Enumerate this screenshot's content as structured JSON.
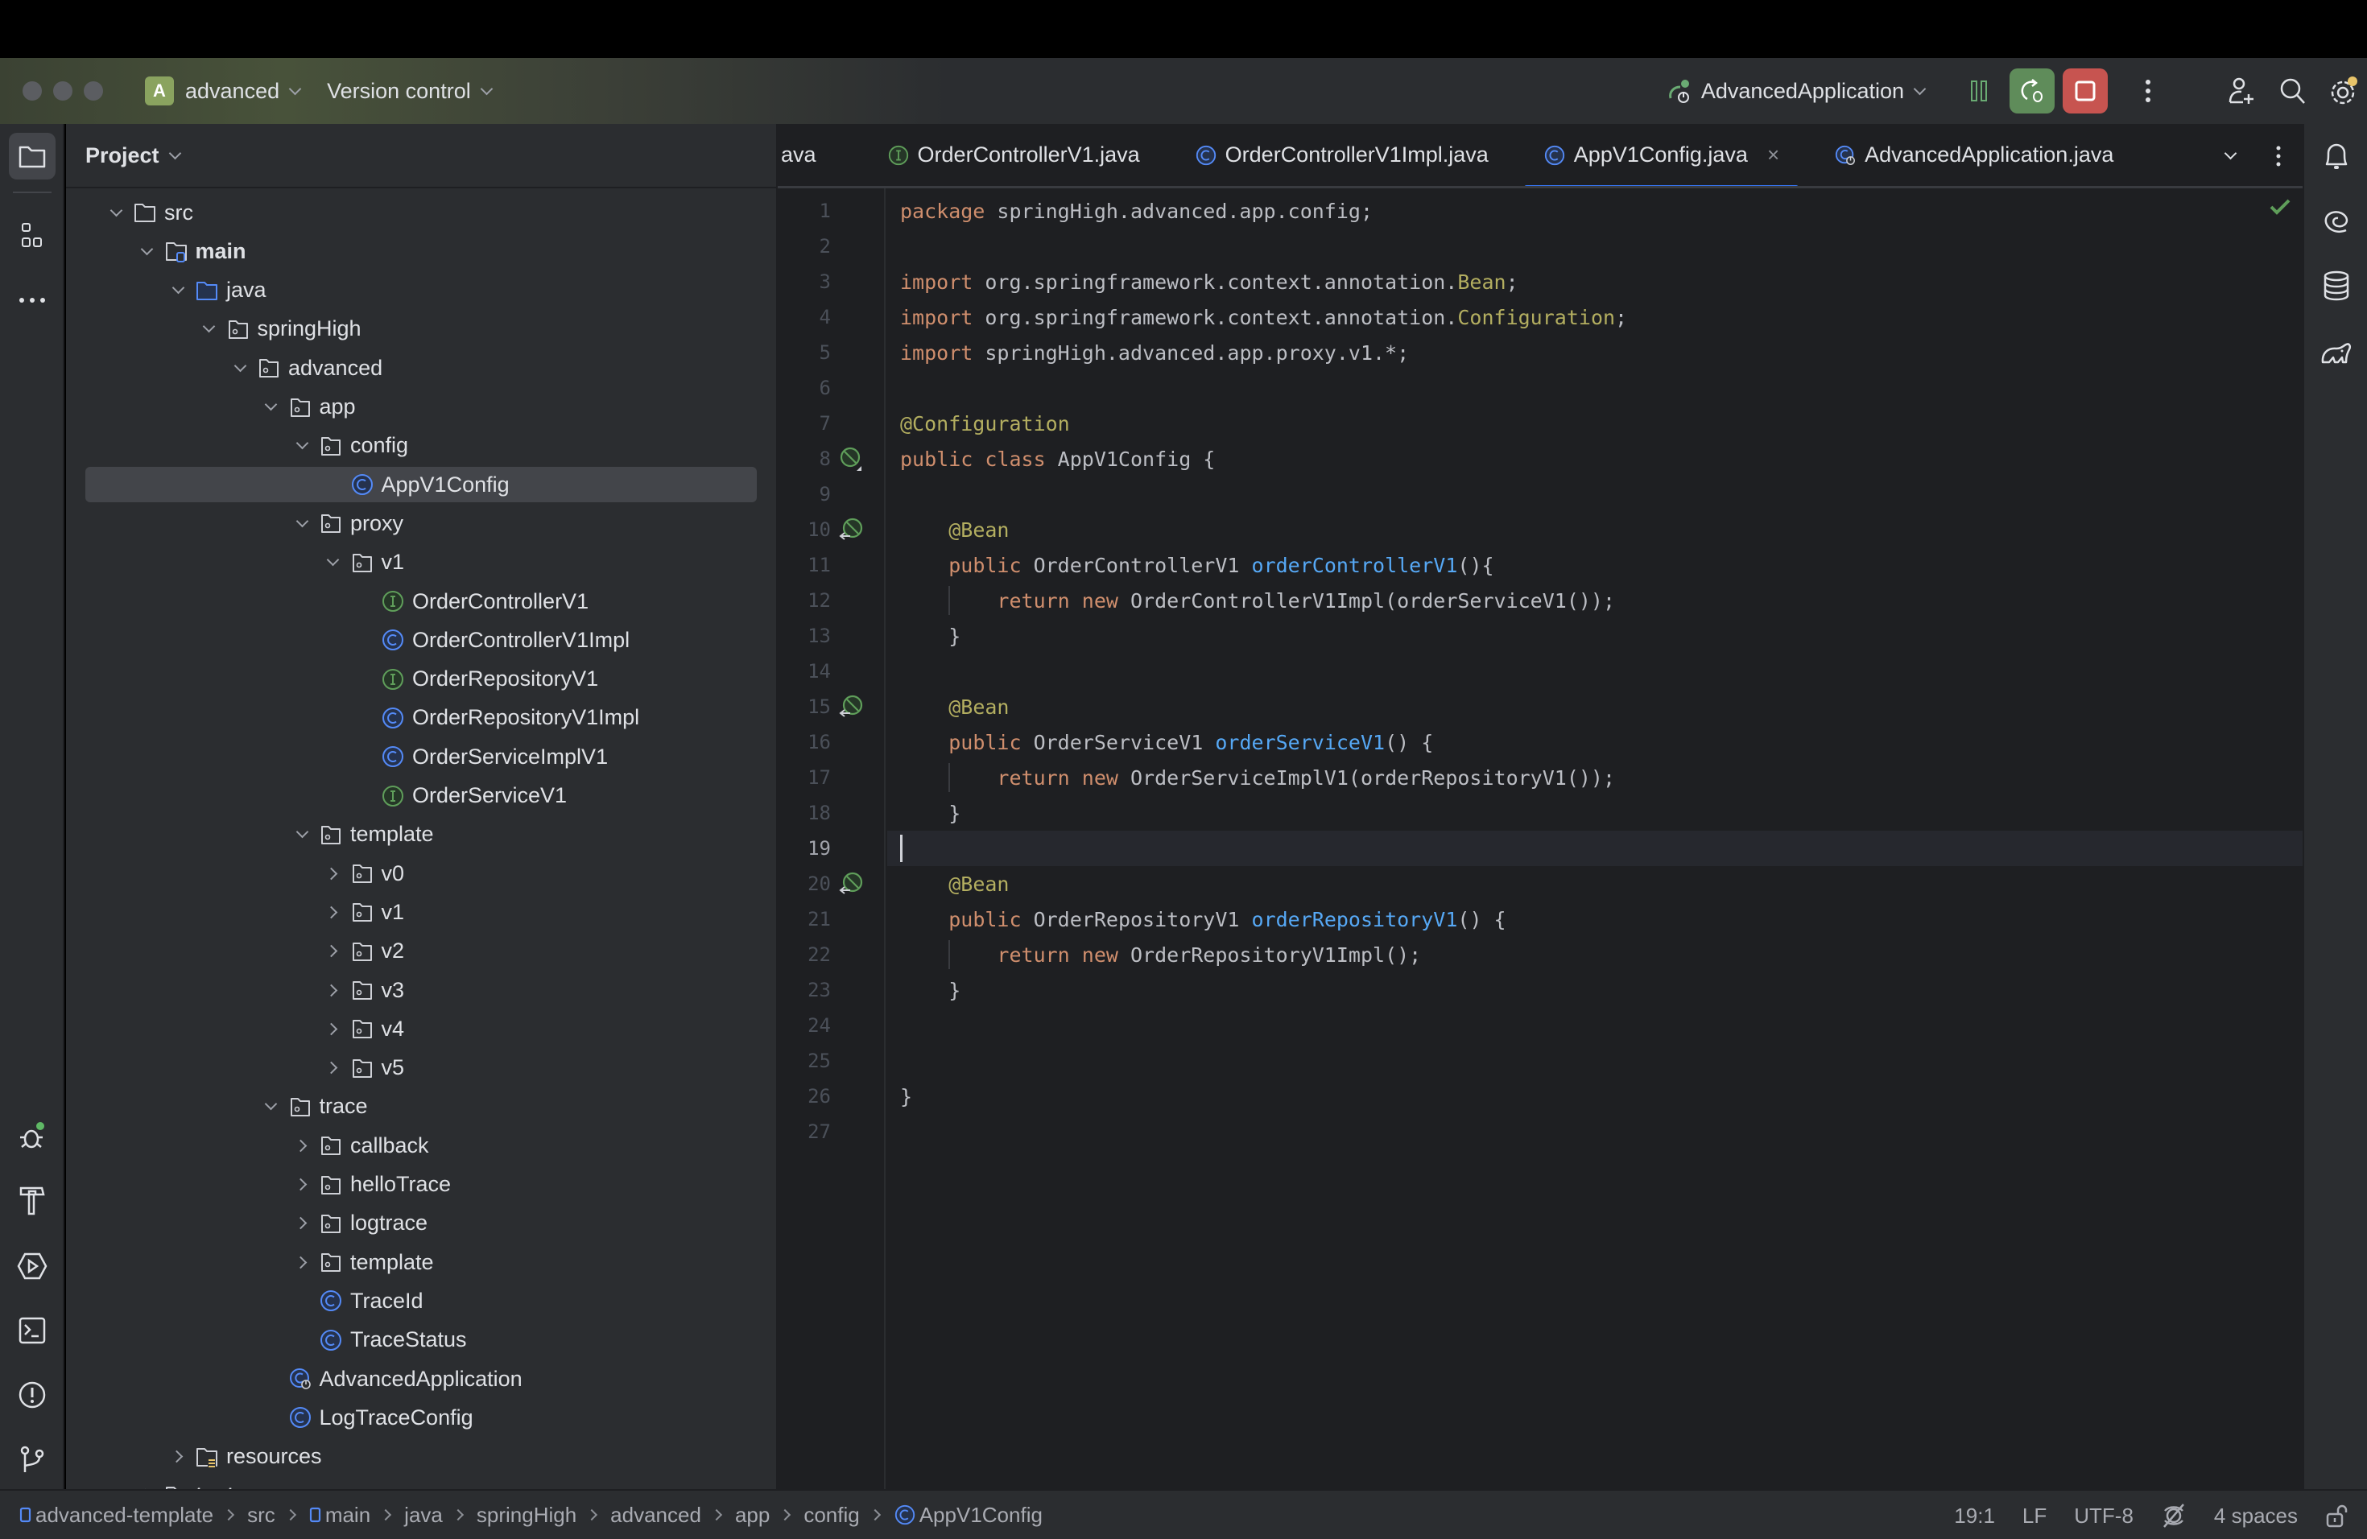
{
  "window": {
    "project_badge": "A",
    "project_name": "advanced",
    "vcs_label": "Version control",
    "run_config": "AdvancedApplication",
    "colors": {
      "accent": "#3574f0",
      "run_green": "#5f8c5a",
      "stop_red": "#c75450",
      "badge": "#8aa35f"
    }
  },
  "project_panel": {
    "title": "Project",
    "tree": [
      {
        "label": "src",
        "depth": 0,
        "arrow": "down",
        "icon": "folder-icon"
      },
      {
        "label": "main",
        "depth": 1,
        "arrow": "down",
        "icon": "source-root-folder-icon",
        "bold": true
      },
      {
        "label": "java",
        "depth": 2,
        "arrow": "down",
        "icon": "java-source-folder-icon"
      },
      {
        "label": "springHigh",
        "depth": 3,
        "arrow": "down",
        "icon": "package-icon"
      },
      {
        "label": "advanced",
        "depth": 4,
        "arrow": "down",
        "icon": "package-icon"
      },
      {
        "label": "app",
        "depth": 5,
        "arrow": "down",
        "icon": "package-icon"
      },
      {
        "label": "config",
        "depth": 6,
        "arrow": "down",
        "icon": "package-icon"
      },
      {
        "label": "AppV1Config",
        "depth": 7,
        "arrow": "none",
        "icon": "class-icon",
        "selected": true
      },
      {
        "label": "proxy",
        "depth": 6,
        "arrow": "down",
        "icon": "package-icon"
      },
      {
        "label": "v1",
        "depth": 7,
        "arrow": "down",
        "icon": "package-icon"
      },
      {
        "label": "OrderControllerV1",
        "depth": 8,
        "arrow": "none",
        "icon": "interface-icon"
      },
      {
        "label": "OrderControllerV1Impl",
        "depth": 8,
        "arrow": "none",
        "icon": "class-icon"
      },
      {
        "label": "OrderRepositoryV1",
        "depth": 8,
        "arrow": "none",
        "icon": "interface-icon"
      },
      {
        "label": "OrderRepositoryV1Impl",
        "depth": 8,
        "arrow": "none",
        "icon": "class-icon"
      },
      {
        "label": "OrderServiceImplV1",
        "depth": 8,
        "arrow": "none",
        "icon": "class-icon"
      },
      {
        "label": "OrderServiceV1",
        "depth": 8,
        "arrow": "none",
        "icon": "interface-icon"
      },
      {
        "label": "template",
        "depth": 6,
        "arrow": "down",
        "icon": "package-icon"
      },
      {
        "label": "v0",
        "depth": 7,
        "arrow": "right",
        "icon": "package-icon"
      },
      {
        "label": "v1",
        "depth": 7,
        "arrow": "right",
        "icon": "package-icon"
      },
      {
        "label": "v2",
        "depth": 7,
        "arrow": "right",
        "icon": "package-icon"
      },
      {
        "label": "v3",
        "depth": 7,
        "arrow": "right",
        "icon": "package-icon"
      },
      {
        "label": "v4",
        "depth": 7,
        "arrow": "right",
        "icon": "package-icon"
      },
      {
        "label": "v5",
        "depth": 7,
        "arrow": "right",
        "icon": "package-icon"
      },
      {
        "label": "trace",
        "depth": 5,
        "arrow": "down",
        "icon": "package-icon"
      },
      {
        "label": "callback",
        "depth": 6,
        "arrow": "right",
        "icon": "package-icon"
      },
      {
        "label": "helloTrace",
        "depth": 6,
        "arrow": "right",
        "icon": "package-icon"
      },
      {
        "label": "logtrace",
        "depth": 6,
        "arrow": "right",
        "icon": "package-icon"
      },
      {
        "label": "template",
        "depth": 6,
        "arrow": "right",
        "icon": "package-icon"
      },
      {
        "label": "TraceId",
        "depth": 6,
        "arrow": "none",
        "icon": "class-icon"
      },
      {
        "label": "TraceStatus",
        "depth": 6,
        "arrow": "none",
        "icon": "class-icon"
      },
      {
        "label": "AdvancedApplication",
        "depth": 5,
        "arrow": "none",
        "icon": "spring-boot-class-icon"
      },
      {
        "label": "LogTraceConfig",
        "depth": 5,
        "arrow": "none",
        "icon": "class-icon"
      },
      {
        "label": "resources",
        "depth": 2,
        "arrow": "right",
        "icon": "resources-folder-icon"
      },
      {
        "label": "test",
        "depth": 1,
        "arrow": "right",
        "icon": "test-folder-icon",
        "bold": true
      }
    ]
  },
  "editor": {
    "tabs": [
      {
        "label": "ava",
        "icon": "none",
        "active": false
      },
      {
        "label": "OrderControllerV1.java",
        "icon": "interface-icon",
        "active": false
      },
      {
        "label": "OrderControllerV1Impl.java",
        "icon": "class-icon",
        "active": false
      },
      {
        "label": "AppV1Config.java",
        "icon": "class-icon",
        "active": true,
        "closable": true
      },
      {
        "label": "AdvancedApplication.java",
        "icon": "spring-boot-class-icon",
        "active": false
      }
    ],
    "current_line": 19,
    "lines": [
      {
        "n": "1",
        "tokens": [
          [
            "kw",
            "package"
          ],
          [
            "t",
            " springHigh.advanced.app.config;"
          ]
        ]
      },
      {
        "n": "2",
        "tokens": []
      },
      {
        "n": "3",
        "tokens": [
          [
            "kw",
            "import"
          ],
          [
            "t",
            " org.springframework.context.annotation."
          ],
          [
            "ann",
            "Bean"
          ],
          [
            "t",
            ";"
          ]
        ]
      },
      {
        "n": "4",
        "tokens": [
          [
            "kw",
            "import"
          ],
          [
            "t",
            " org.springframework.context.annotation."
          ],
          [
            "ann",
            "Configuration"
          ],
          [
            "t",
            ";"
          ]
        ]
      },
      {
        "n": "5",
        "tokens": [
          [
            "kw",
            "import"
          ],
          [
            "t",
            " springHigh.advanced.app.proxy.v1.*;"
          ]
        ]
      },
      {
        "n": "6",
        "tokens": []
      },
      {
        "n": "7",
        "tokens": [
          [
            "ann",
            "@Configuration"
          ]
        ]
      },
      {
        "n": "8",
        "gutter": "spring-bean-config-icon",
        "tokens": [
          [
            "kw",
            "public class"
          ],
          [
            "t",
            " AppV1Config {"
          ]
        ]
      },
      {
        "n": "9",
        "tokens": []
      },
      {
        "n": "10",
        "gutter": "spring-bean-icon",
        "tokens": [
          [
            "t",
            "    "
          ],
          [
            "ann",
            "@Bean"
          ]
        ]
      },
      {
        "n": "11",
        "tokens": [
          [
            "t",
            "    "
          ],
          [
            "kw",
            "public"
          ],
          [
            "t",
            " OrderControllerV1 "
          ],
          [
            "fn",
            "orderControllerV1"
          ],
          [
            "t",
            "(){"
          ]
        ]
      },
      {
        "n": "12",
        "tokens": [
          [
            "t",
            "        "
          ],
          [
            "kw",
            "return new"
          ],
          [
            "t",
            " OrderControllerV1Impl(orderServiceV1());"
          ]
        ]
      },
      {
        "n": "13",
        "tokens": [
          [
            "t",
            "    }"
          ]
        ]
      },
      {
        "n": "14",
        "tokens": []
      },
      {
        "n": "15",
        "gutter": "spring-bean-icon",
        "tokens": [
          [
            "t",
            "    "
          ],
          [
            "ann",
            "@Bean"
          ]
        ]
      },
      {
        "n": "16",
        "tokens": [
          [
            "t",
            "    "
          ],
          [
            "kw",
            "public"
          ],
          [
            "t",
            " OrderServiceV1 "
          ],
          [
            "fn",
            "orderServiceV1"
          ],
          [
            "t",
            "() {"
          ]
        ]
      },
      {
        "n": "17",
        "tokens": [
          [
            "t",
            "        "
          ],
          [
            "kw",
            "return new"
          ],
          [
            "t",
            " OrderServiceImplV1(orderRepositoryV1());"
          ]
        ]
      },
      {
        "n": "18",
        "tokens": [
          [
            "t",
            "    }"
          ]
        ]
      },
      {
        "n": "19",
        "tokens": []
      },
      {
        "n": "20",
        "gutter": "spring-bean-icon",
        "tokens": [
          [
            "t",
            "    "
          ],
          [
            "ann",
            "@Bean"
          ]
        ]
      },
      {
        "n": "21",
        "tokens": [
          [
            "t",
            "    "
          ],
          [
            "kw",
            "public"
          ],
          [
            "t",
            " OrderRepositoryV1 "
          ],
          [
            "fn",
            "orderRepositoryV1"
          ],
          [
            "t",
            "() {"
          ]
        ]
      },
      {
        "n": "22",
        "tokens": [
          [
            "t",
            "        "
          ],
          [
            "kw",
            "return new"
          ],
          [
            "t",
            " OrderRepositoryV1Impl();"
          ]
        ]
      },
      {
        "n": "23",
        "tokens": [
          [
            "t",
            "    }"
          ]
        ]
      },
      {
        "n": "24",
        "tokens": []
      },
      {
        "n": "25",
        "tokens": []
      },
      {
        "n": "26",
        "tokens": [
          [
            "t",
            "}"
          ]
        ]
      },
      {
        "n": "27",
        "tokens": []
      }
    ]
  },
  "breadcrumbs": [
    {
      "label": "advanced-template",
      "icon": "module-icon"
    },
    {
      "label": "src",
      "icon": "none"
    },
    {
      "label": "main",
      "icon": "module-icon"
    },
    {
      "label": "java",
      "icon": "none"
    },
    {
      "label": "springHigh",
      "icon": "none"
    },
    {
      "label": "advanced",
      "icon": "none"
    },
    {
      "label": "app",
      "icon": "none"
    },
    {
      "label": "config",
      "icon": "none"
    },
    {
      "label": "AppV1Config",
      "icon": "class-icon"
    }
  ],
  "status": {
    "position": "19:1",
    "line_separator": "LF",
    "encoding": "UTF-8",
    "indent": "4 spaces"
  }
}
